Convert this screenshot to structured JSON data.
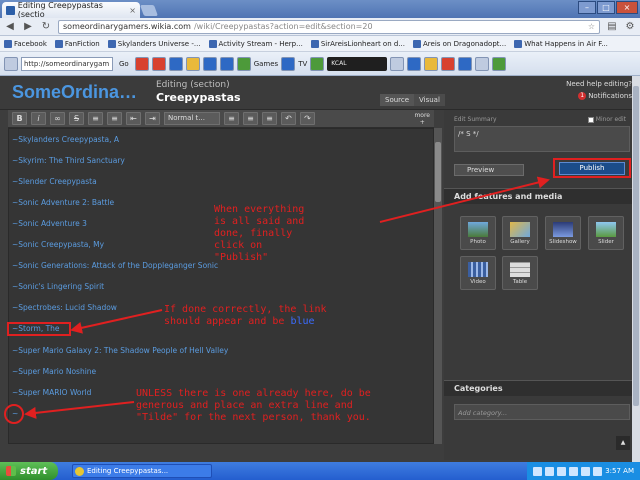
{
  "browser": {
    "tab_title": "Editing Creepypastas (sectio",
    "url_host": "someordinarygamers.wikia.com",
    "url_path": "/wiki/Creepypastas?action=edit&section=20"
  },
  "bookmarks": [
    "Facebook",
    "FanFiction",
    "Skylanders Universe -...",
    "Activity Stream - Herp...",
    "SirAreisLionheart on d...",
    "Areis on Dragonadopt...",
    "What Happens in Air F..."
  ],
  "ext_toolbar": {
    "url": "http://someordinarygam",
    "go": "Go",
    "games": "Games",
    "tv": "TV",
    "player": "KCAL"
  },
  "wiki": {
    "name": "SomeOrdina…",
    "editing_label": "Editing (section)",
    "page_title": "Creepypastas",
    "need_help": "Need help editing?",
    "notifications": "Notifications",
    "notif_count": "1",
    "mode_source": "Source",
    "mode_visual": "Visual"
  },
  "editor": {
    "format_select": "Normal t...",
    "more": "more",
    "lines": [
      "~Skylanders Creepypasta, A",
      "~Skyrim: The Third Sanctuary",
      "~Slender Creepypasta",
      "~Sonic Adventure 2: Battle",
      "~Sonic Adventure 3",
      "~Sonic Creepypasta, My",
      "~Sonic Generations: Attack of the Doppleganger Sonic",
      "~Sonic's Lingering Spirit",
      "~Spectrobes: Lucid Shadow",
      "~Storm, The",
      "~Super Mario Galaxy 2: The Shadow People of Hell Valley",
      "~Super Mario Noshine",
      "~Super MARIO World",
      "~"
    ]
  },
  "rail": {
    "summary_label": "Edit Summary",
    "minor_edit": "Minor edit",
    "summary_value": "/* S */",
    "preview": "Preview",
    "publish": "Publish",
    "features_title": "Add features and media",
    "features": [
      "Photo",
      "Gallery",
      "Slideshow",
      "Slider",
      "Video",
      "Table"
    ],
    "categories_title": "Categories",
    "category_placeholder": "Add category..."
  },
  "annotations": {
    "publish_note": "When everything\nis all said and\ndone, finally\nclick on\n\"Publish\"",
    "link_note_1": "If done correctly, the link",
    "link_note_2": "should appear and be ",
    "link_note_blue": "blue",
    "tilde_note": "UNLESS there is one already here, do be\ngenerous and place an extra line and\n\"Tilde\" for the next person, thank you."
  },
  "taskbar": {
    "start": "start",
    "task": "Editing Creepypastas...",
    "clock": "3:57 AM"
  }
}
